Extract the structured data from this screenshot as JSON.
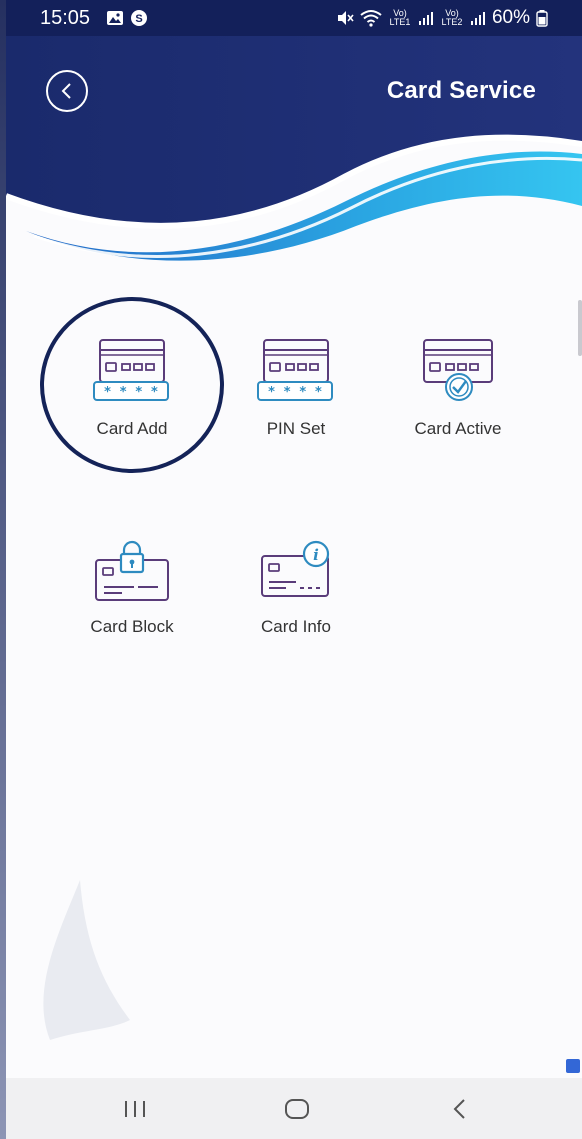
{
  "status_bar": {
    "time": "15:05",
    "lte1": "Vo) LTE1",
    "lte2": "Vo) LTE2",
    "battery": "60%"
  },
  "header": {
    "title": "Card Service"
  },
  "services": [
    {
      "label": "Card Add",
      "icon": "card-add-icon"
    },
    {
      "label": "PIN Set",
      "icon": "pin-set-icon"
    },
    {
      "label": "Card Active",
      "icon": "card-active-icon"
    },
    {
      "label": "Card Block",
      "icon": "card-block-icon"
    },
    {
      "label": "Card Info",
      "icon": "card-info-icon"
    }
  ],
  "colors": {
    "header_dark": "#1a2a6c",
    "wave_light": "#2eb4e8",
    "icon_purple": "#5a3c7a",
    "icon_blue": "#2e8bc0",
    "ring": "#142358"
  }
}
